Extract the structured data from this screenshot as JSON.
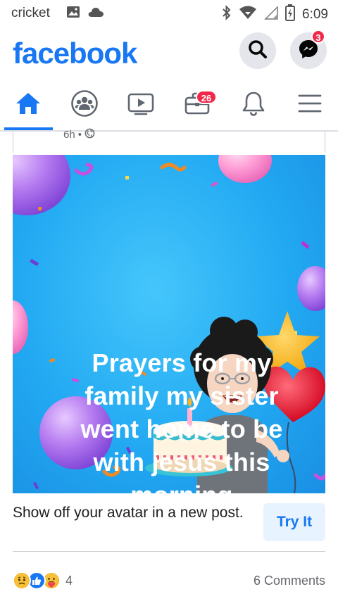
{
  "status_bar": {
    "carrier": "cricket",
    "time": "6:09",
    "left_icons": [
      "image-icon",
      "cloud-icon"
    ],
    "right_icons": [
      "bluetooth-icon",
      "wifi-icon",
      "signal-icon",
      "battery-icon"
    ]
  },
  "header": {
    "logo": "facebook",
    "search_icon": "search-icon",
    "messenger_icon": "messenger-icon",
    "messenger_badge": "3"
  },
  "tabs": [
    {
      "name": "home",
      "icon": "home-icon",
      "active": true
    },
    {
      "name": "groups",
      "icon": "groups-icon"
    },
    {
      "name": "watch",
      "icon": "video-icon"
    },
    {
      "name": "marketplace",
      "icon": "briefcase-icon",
      "badge": "26"
    },
    {
      "name": "notifications",
      "icon": "bell-icon"
    },
    {
      "name": "menu",
      "icon": "menu-icon"
    }
  ],
  "post": {
    "time": "6h",
    "separator": "•",
    "privacy_icon": "globe-icon",
    "image_text_lines": [
      "Prayers for my",
      "family  my sister",
      "went  home to be",
      "with  jesus  this",
      "morning"
    ],
    "cta_text": "Show off your avatar in a new post.",
    "cta_button": "Try It",
    "reaction_count": "4",
    "reaction_icons": [
      "sad-reaction-icon",
      "like-reaction-icon",
      "care-reaction-icon"
    ],
    "comments": "6 Comments"
  },
  "colors": {
    "brand": "#1877f2",
    "badge": "#f02849",
    "image_bg": "#22a9f2"
  }
}
